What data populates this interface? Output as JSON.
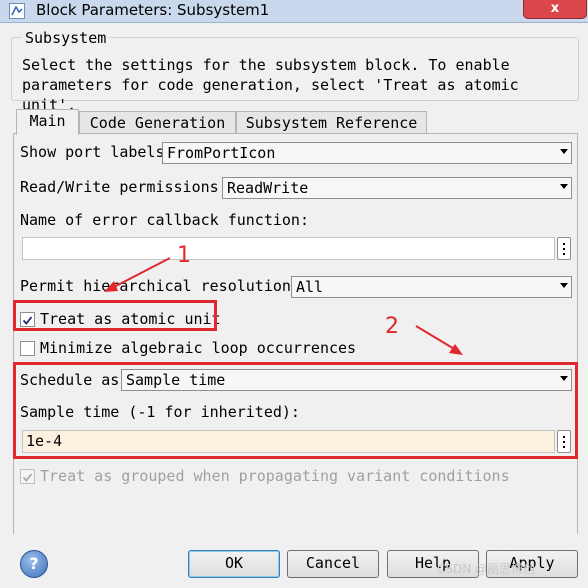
{
  "window": {
    "title": "Block Parameters: Subsystem1",
    "close_glyph": "x"
  },
  "group": {
    "legend": "Subsystem",
    "description_line1": "Select the settings for the subsystem block. To enable",
    "description_line2": "parameters for code generation, select 'Treat as atomic unit'."
  },
  "tabs": [
    {
      "label": "Main",
      "active": true
    },
    {
      "label": "Code Generation",
      "active": false
    },
    {
      "label": "Subsystem Reference",
      "active": false
    }
  ],
  "main": {
    "show_port_labels": {
      "label": "Show port labels",
      "value": "FromPortIcon"
    },
    "read_write": {
      "label": "Read/Write permissions:",
      "value": "ReadWrite"
    },
    "error_callback": {
      "label": "Name of error callback function:",
      "value": ""
    },
    "permit_resolution": {
      "label": "Permit hierarchical resolution:",
      "value": "All"
    },
    "treat_atomic": {
      "label": "Treat as atomic unit",
      "checked": true
    },
    "minimize_loop": {
      "label": "Minimize algebraic loop occurrences",
      "checked": false
    },
    "schedule_as": {
      "label": "Schedule as",
      "value": "Sample time"
    },
    "sample_time": {
      "label": "Sample time (-1 for inherited):",
      "value": "1e-4"
    },
    "treat_grouped": {
      "label": "Treat as grouped when propagating variant conditions",
      "checked": true,
      "disabled": true
    }
  },
  "buttons": {
    "help_glyph": "?",
    "ok": "OK",
    "cancel": "Cancel",
    "help": "Help",
    "apply": "Apply"
  },
  "annotations": {
    "marker1": "1",
    "marker2": "2",
    "color": "#e0282e"
  },
  "watermark": "CSDN @丽思博创"
}
